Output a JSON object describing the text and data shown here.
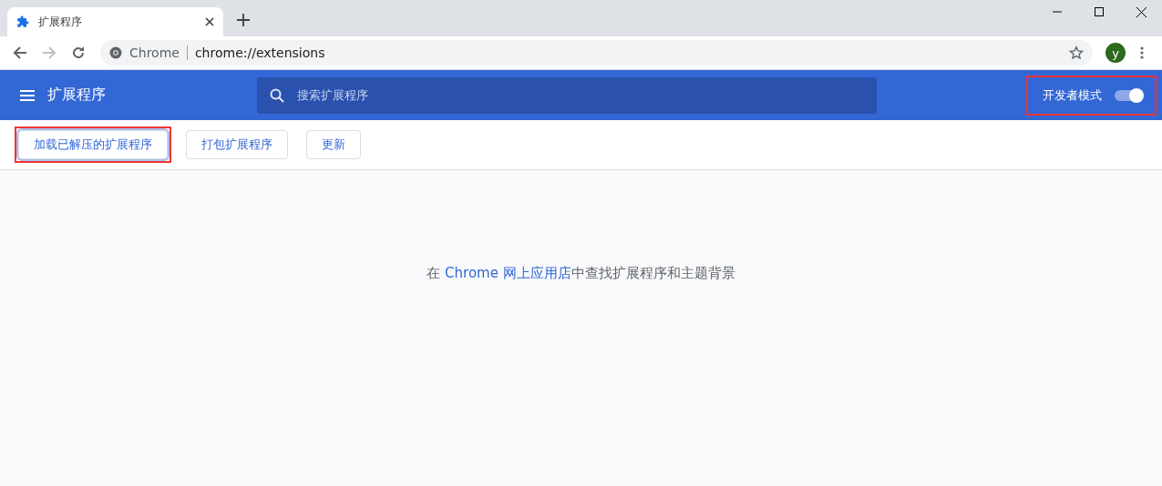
{
  "tab": {
    "title": "扩展程序",
    "selected": true
  },
  "omnibox": {
    "site": "Chrome",
    "url": "chrome://extensions"
  },
  "profile": {
    "initial": "y"
  },
  "header": {
    "title": "扩展程序",
    "search": {
      "placeholder": "搜索扩展程序"
    },
    "dev_mode": {
      "label": "开发者模式",
      "on": true,
      "highlighted": true
    }
  },
  "toolbar": [
    {
      "label": "加载已解压的扩展程序",
      "highlighted": true
    },
    {
      "label": "打包扩展程序",
      "highlighted": false
    },
    {
      "label": "更新",
      "highlighted": false
    }
  ],
  "message": {
    "before": "在 ",
    "link": "Chrome 网上应用店",
    "after": "中查找扩展程序和主题背景"
  }
}
